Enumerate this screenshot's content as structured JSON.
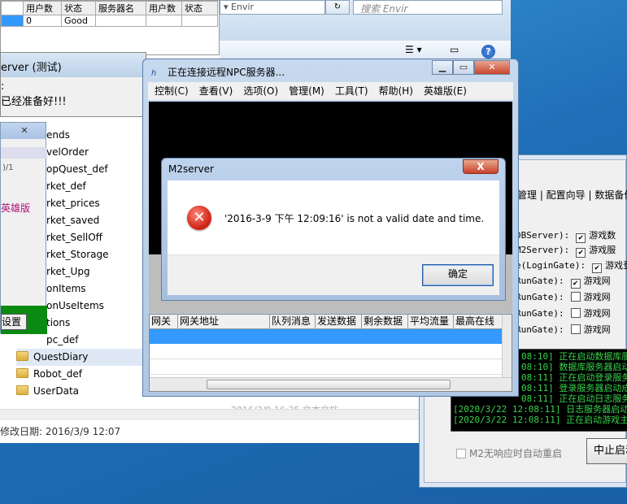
{
  "explorer": {
    "address_tail": "Envir",
    "search_placeholder": "搜索 Envir",
    "files": [
      "ends",
      "velOrder",
      "opQuest_def",
      "rket_def",
      "rket_prices",
      "rket_saved",
      "rket_SellOff",
      "rket_Storage",
      "rket_Upg",
      "onItems",
      "onUseItems",
      "tions",
      "pc_def",
      "QuestDiary",
      "Robot_def",
      "UserData"
    ],
    "modified": "修改日期: 2016/3/9 12:07",
    "faded_row": "2016/3/9 16:25    文本文档"
  },
  "mini_table": {
    "headers": [
      "用户数",
      "状态",
      "服务器名",
      "用户数",
      "状态"
    ],
    "row": [
      "0",
      "Good",
      "",
      "",
      ""
    ]
  },
  "server_win": {
    "title": "erver (测试)",
    "line1": ":",
    "line2": "已经准备好!!!"
  },
  "left_dialog": {
    "text1": ")/1",
    "text2": "英雄版",
    "set_button": "设置"
  },
  "npc": {
    "title": "正在连接远程NPC服务器...",
    "menu": [
      "控制(C)",
      "查看(V)",
      "选项(O)",
      "管理(M)",
      "工具(T)",
      "帮助(H)",
      "英雄版(E)"
    ],
    "columns": [
      "网关",
      "网关地址",
      "队列消息",
      "发送数据",
      "剩余数据",
      "平均流量",
      "最高在线"
    ]
  },
  "error_dialog": {
    "title": "M2server",
    "message": "'2016-3-9 下午 12:09:16' is not a valid date and time.",
    "ok_label": "确定",
    "close_label": "X"
  },
  "m2_right": {
    "tabs": "管理 | 配置向导 | 数据备份",
    "checks": [
      {
        "label": "DBServer):",
        "text": "游戏数",
        "checked": true
      },
      {
        "label": "M2Server):",
        "text": "游戏服",
        "checked": true
      },
      {
        "label": "e(LoginGate):",
        "text": "游戏登",
        "checked": true
      },
      {
        "label": "RunGate):",
        "text": "游戏网",
        "checked": true
      },
      {
        "label": "RunGate):",
        "text": "游戏网",
        "checked": false
      },
      {
        "label": "RunGate):",
        "text": "游戏网",
        "checked": false
      },
      {
        "label": "RunGate):",
        "text": "游戏网",
        "checked": false
      }
    ],
    "console_lines": [
      "08:10] 正在启动数据库服务",
      "08:10] 数据库服务器启动",
      "08:11] 正在启动登录服务",
      "08:11] 登录服务器启动成",
      "08:11] 正在启动日志服务",
      "[2020/3/22 12:08:11] 日志服务器启动成功",
      "[2020/3/22 12:08:11] 正在启动游戏主程"
    ],
    "restart_label": "M2无响应时自动重启",
    "stop_label": "中止启动"
  }
}
